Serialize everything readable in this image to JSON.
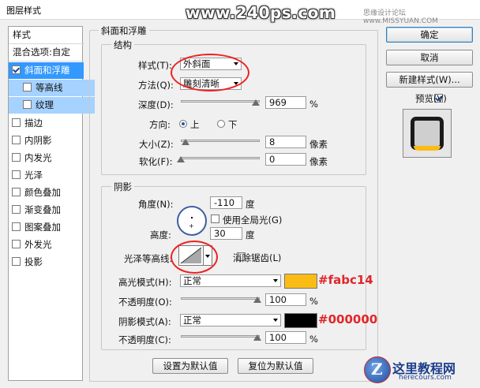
{
  "window": {
    "title": "图层样式"
  },
  "watermark": {
    "banner": "www.240ps.com",
    "corner": "思缘设计论坛 www.MISSYUAN.COM",
    "logo": "这里教程网",
    "logo_url": "herecours.com"
  },
  "sidebar": {
    "items": [
      {
        "label": "样式",
        "checked": null
      },
      {
        "label": "混合选项:自定",
        "checked": null
      },
      {
        "label": "斜面和浮雕",
        "checked": true
      },
      {
        "label": "等高线",
        "checked": false
      },
      {
        "label": "纹理",
        "checked": false
      },
      {
        "label": "描边",
        "checked": false
      },
      {
        "label": "内阴影",
        "checked": false
      },
      {
        "label": "内发光",
        "checked": false
      },
      {
        "label": "光泽",
        "checked": false
      },
      {
        "label": "颜色叠加",
        "checked": false
      },
      {
        "label": "渐变叠加",
        "checked": false
      },
      {
        "label": "图案叠加",
        "checked": false
      },
      {
        "label": "外发光",
        "checked": false
      },
      {
        "label": "投影",
        "checked": false
      }
    ]
  },
  "bevel": {
    "section_title": "斜面和浮雕",
    "structure": {
      "title": "结构",
      "style_label": "样式(T):",
      "style_value": "外斜面",
      "technique_label": "方法(Q):",
      "technique_value": "雕刻清晰",
      "depth_label": "深度(D):",
      "depth_value": "969",
      "depth_unit": "%",
      "depth_fraction": 0.97,
      "direction_label": "方向:",
      "direction_up": "上",
      "direction_down": "下",
      "size_label": "大小(Z):",
      "size_value": "8",
      "size_unit": "像素",
      "size_fraction": 0.03,
      "soften_label": "软化(F):",
      "soften_value": "0",
      "soften_unit": "像素",
      "soften_fraction": 0.0
    },
    "shading": {
      "title": "阴影",
      "angle_label": "角度(N):",
      "angle_value": "-110",
      "angle_unit": "度",
      "global_light_label": "使用全局光(G)",
      "altitude_label": "高度:",
      "altitude_value": "30",
      "altitude_unit": "度",
      "gloss_contour_label": "光泽等高线:",
      "anti_alias_label": "消除锯齿(L)",
      "highlight_mode_label": "高光模式(H):",
      "highlight_mode_value": "正常",
      "highlight_color": "#fabc14",
      "highlight_annotation": "#fabc14",
      "highlight_opacity_label": "不透明度(O):",
      "highlight_opacity_value": "100",
      "highlight_opacity_unit": "%",
      "highlight_opacity_fraction": 1.0,
      "shadow_mode_label": "阴影模式(A):",
      "shadow_mode_value": "正常",
      "shadow_color": "#000000",
      "shadow_annotation": "#000000",
      "shadow_opacity_label": "不透明度(C):",
      "shadow_opacity_value": "100",
      "shadow_opacity_unit": "%",
      "shadow_opacity_fraction": 1.0
    },
    "make_default": "设置为默认值",
    "reset_default": "复位为默认值"
  },
  "actions": {
    "ok": "确定",
    "cancel": "取消",
    "new_style": "新建样式(W)...",
    "preview_label": "预览(V)",
    "preview_checked": true
  }
}
